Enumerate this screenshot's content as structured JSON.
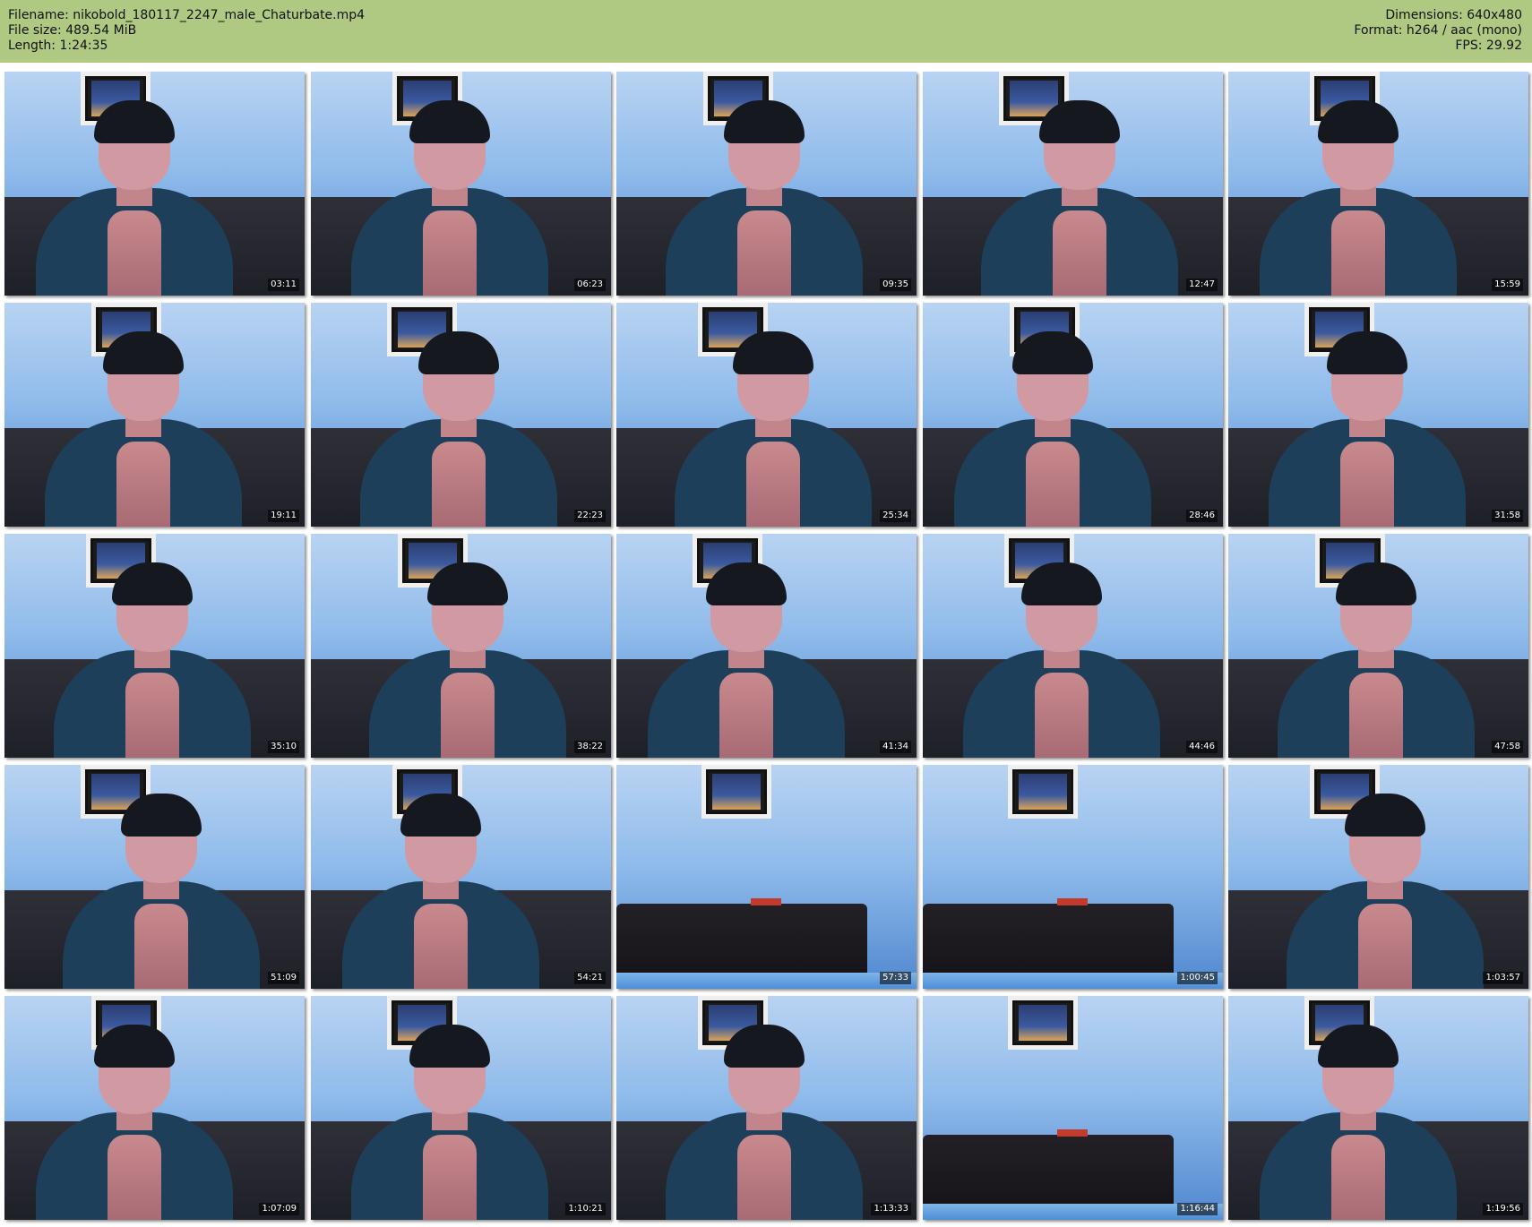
{
  "header": {
    "filename": "Filename: nikobold_180117_2247_male_Chaturbate.mp4",
    "filesize": "File size: 489.54 MiB",
    "length": "Length: 1:24:35",
    "dimensions": "Dimensions: 640x480",
    "format": "Format: h264 / aac (mono)",
    "fps": "FPS: 29.92"
  },
  "colors": {
    "header_bg": "#b0c982",
    "page_bg": "#ffffff",
    "timestamp_text": "#ffffff"
  },
  "thumbnails": [
    {
      "time": "03:11",
      "scene": "person"
    },
    {
      "time": "06:23",
      "scene": "person"
    },
    {
      "time": "09:35",
      "scene": "person"
    },
    {
      "time": "12:47",
      "scene": "person"
    },
    {
      "time": "15:59",
      "scene": "person"
    },
    {
      "time": "19:11",
      "scene": "person"
    },
    {
      "time": "22:23",
      "scene": "person"
    },
    {
      "time": "25:34",
      "scene": "person"
    },
    {
      "time": "28:46",
      "scene": "person"
    },
    {
      "time": "31:58",
      "scene": "person"
    },
    {
      "time": "35:10",
      "scene": "person"
    },
    {
      "time": "38:22",
      "scene": "person"
    },
    {
      "time": "41:34",
      "scene": "person"
    },
    {
      "time": "44:46",
      "scene": "person"
    },
    {
      "time": "47:58",
      "scene": "person"
    },
    {
      "time": "51:09",
      "scene": "person"
    },
    {
      "time": "54:21",
      "scene": "person"
    },
    {
      "time": "57:33",
      "scene": "empty-bed"
    },
    {
      "time": "1:00:45",
      "scene": "empty-bed"
    },
    {
      "time": "1:03:57",
      "scene": "person"
    },
    {
      "time": "1:07:09",
      "scene": "person"
    },
    {
      "time": "1:10:21",
      "scene": "person"
    },
    {
      "time": "1:13:33",
      "scene": "person"
    },
    {
      "time": "1:16:44",
      "scene": "empty-bed"
    },
    {
      "time": "1:19:56",
      "scene": "person"
    }
  ]
}
